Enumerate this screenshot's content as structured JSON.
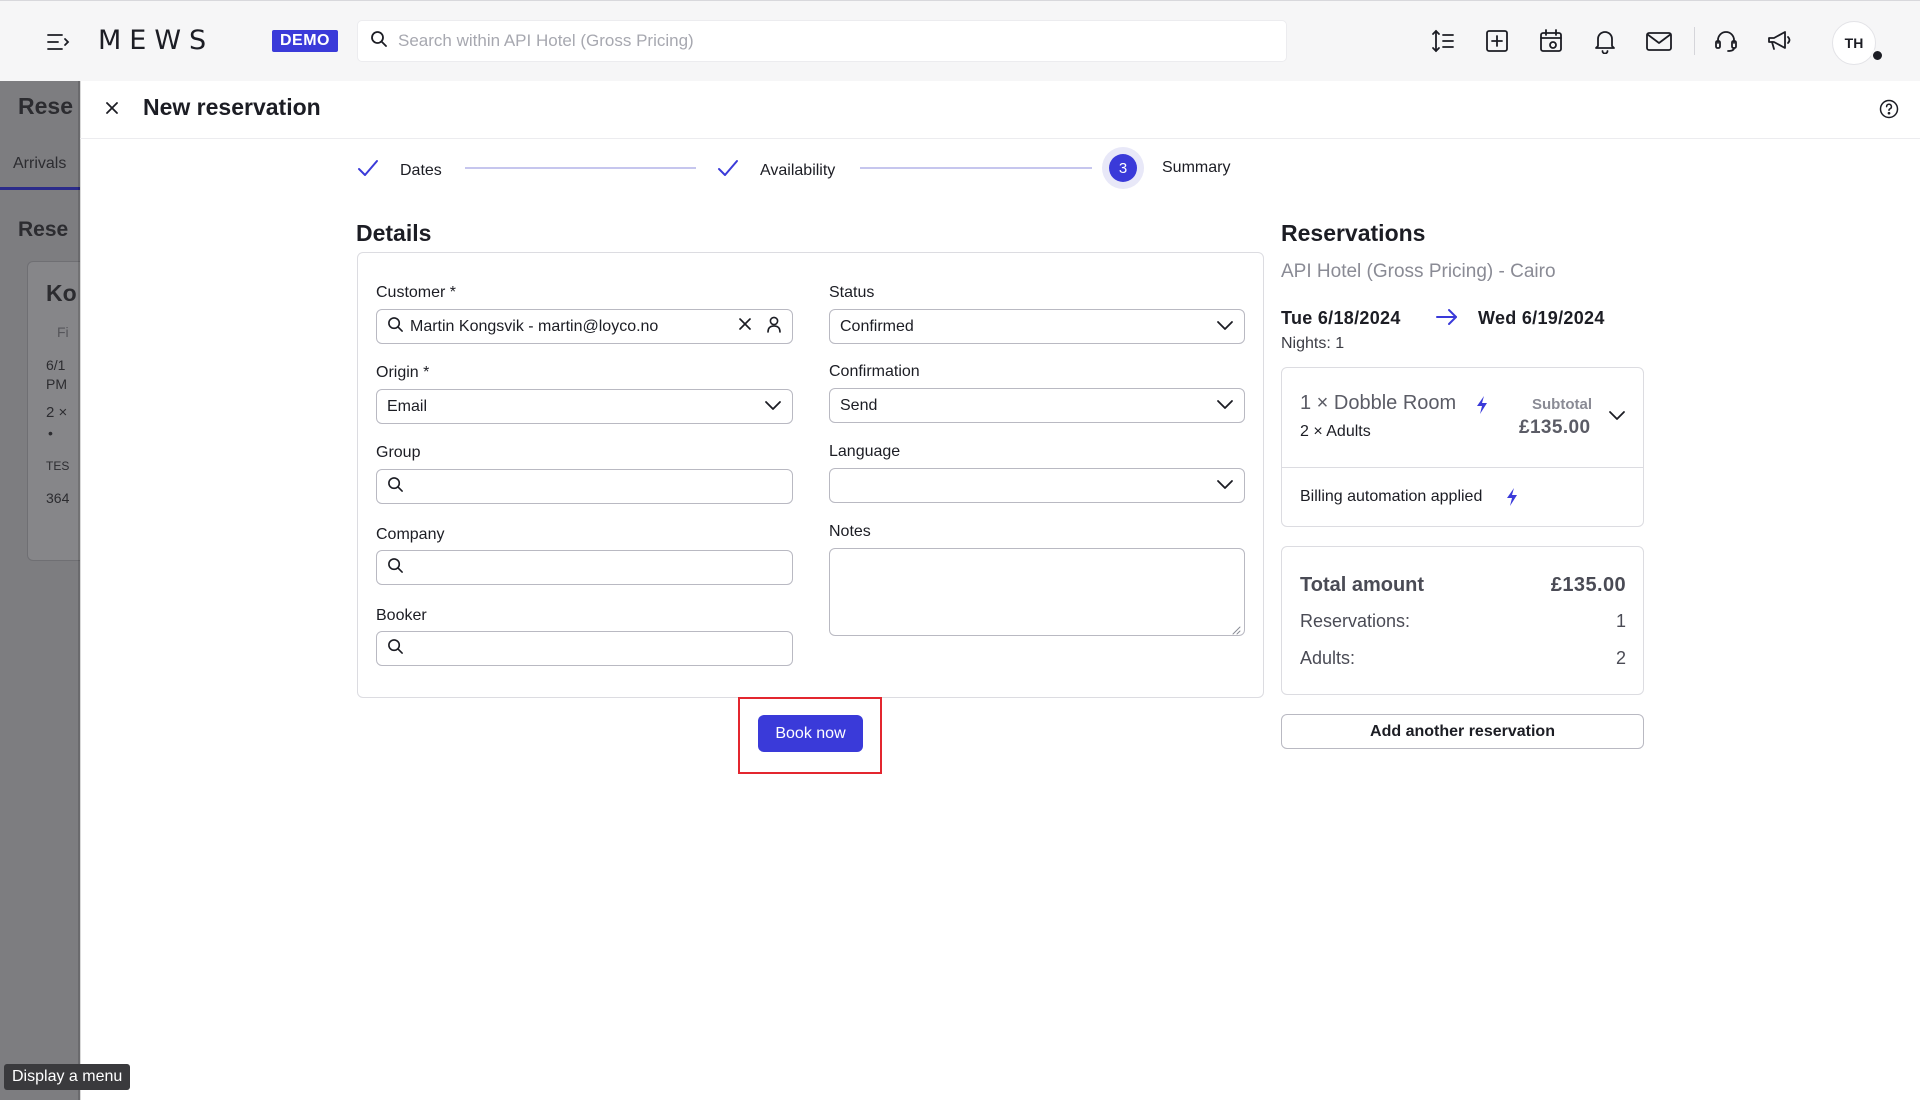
{
  "app": {
    "logo": "MEWS",
    "environment_badge": "DEMO",
    "search_placeholder": "Search within API Hotel (Gross Pricing)",
    "user_initials": "TH"
  },
  "underlay": {
    "page_title": "Rese",
    "tab_label": "Arrivals",
    "section_title": "Rese",
    "card_title": "Ko",
    "card_chip": "Fi",
    "card_date": "6/1",
    "card_time": "PM",
    "card_count": "2 ×",
    "card_bullet": "•",
    "card_code": "TES",
    "card_number": "364"
  },
  "drawer": {
    "title": "New reservation",
    "steps": [
      {
        "label": "Dates",
        "state": "done"
      },
      {
        "label": "Availability",
        "state": "done"
      },
      {
        "label": "Summary",
        "state": "active",
        "number": "3"
      }
    ]
  },
  "details": {
    "title": "Details",
    "customer": {
      "label": "Customer *",
      "value": "Martin Kongsvik - martin@loyco.no"
    },
    "origin": {
      "label": "Origin *",
      "value": "Email"
    },
    "group": {
      "label": "Group",
      "value": ""
    },
    "company": {
      "label": "Company",
      "value": ""
    },
    "booker": {
      "label": "Booker",
      "value": ""
    },
    "status": {
      "label": "Status",
      "value": "Confirmed"
    },
    "confirmation": {
      "label": "Confirmation",
      "value": "Send"
    },
    "language": {
      "label": "Language",
      "value": ""
    },
    "notes": {
      "label": "Notes",
      "value": ""
    },
    "book_button": "Book now"
  },
  "reservations": {
    "title": "Reservations",
    "hotel": "API Hotel (Gross Pricing) - Cairo",
    "check_in": "Tue 6/18/2024",
    "check_out": "Wed 6/19/2024",
    "nights": "Nights: 1",
    "room": {
      "name": "1 × Dobble Room",
      "guests": "2 × Adults",
      "subtotal_label": "Subtotal",
      "subtotal_value": "£135.00",
      "billing_note": "Billing automation applied"
    },
    "totals": {
      "total_label": "Total amount",
      "total_value": "£135.00",
      "reservations_label": "Reservations:",
      "reservations_value": "1",
      "adults_label": "Adults:",
      "adults_value": "2"
    },
    "add_button": "Add another reservation"
  },
  "tooltip": "Display a menu",
  "colors": {
    "accent": "#3a3ad9",
    "highlight": "#e3262f",
    "border": "#dcdce1"
  }
}
